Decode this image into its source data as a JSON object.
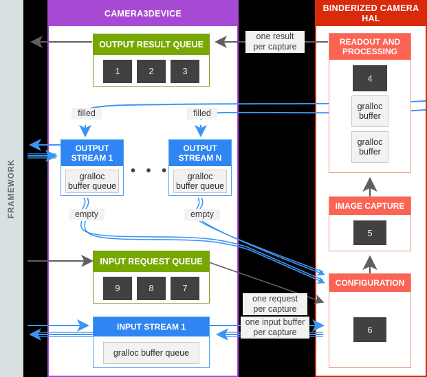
{
  "framework": {
    "label": "FRAMEWORK"
  },
  "panels": {
    "device": {
      "title": "CAMERA3DEVICE",
      "color": "#a64ad4"
    },
    "hal": {
      "title": "BINDERIZED CAMERA HAL",
      "color": "#d92a0c"
    }
  },
  "device_panel": {
    "output_result_queue": {
      "title": "OUTPUT RESULT QUEUE",
      "tiles": [
        "1",
        "2",
        "3"
      ],
      "color": "#76a800"
    },
    "output_stream_1": {
      "title": "OUTPUT\nSTREAM 1",
      "buffer_label": "gralloc\nbuffer queue",
      "color": "#2f85f1"
    },
    "output_stream_n": {
      "title": "OUTPUT\nSTREAM N",
      "buffer_label": "gralloc\nbuffer queue",
      "color": "#2f85f1"
    },
    "stream_ellipsis": "• • •",
    "input_request_queue": {
      "title": "INPUT REQUEST QUEUE",
      "tiles": [
        "9",
        "8",
        "7"
      ],
      "color": "#76a800"
    },
    "input_stream_1": {
      "title": "INPUT STREAM 1",
      "buffer_label": "gralloc buffer queue",
      "color": "#2f85f1"
    }
  },
  "hal_panel": {
    "readout_and_processing": {
      "title": "READOUT AND PROCESSING",
      "tile": "4",
      "buffers": [
        "gralloc\nbuffer",
        "gralloc\nbuffer"
      ],
      "color": "#fb6354"
    },
    "image_capture": {
      "title": "IMAGE CAPTURE",
      "tile": "5",
      "color": "#fb6354"
    },
    "configuration": {
      "title": "CONFIGURATION",
      "tile": "6",
      "color": "#fb6354"
    }
  },
  "edge_labels": {
    "one_result_per_capture": "one result\nper capture",
    "one_request_per_capture": "one request\nper capture",
    "one_input_buffer_per_capture": "one input buffer\nper capture",
    "filled_1": "filled",
    "filled_n": "filled",
    "empty_1": "empty",
    "empty_n": "empty"
  },
  "colors": {
    "gray_arrow": "#5f5f5f",
    "blue_arrow": "#3d95f2",
    "tile": "#414141"
  }
}
